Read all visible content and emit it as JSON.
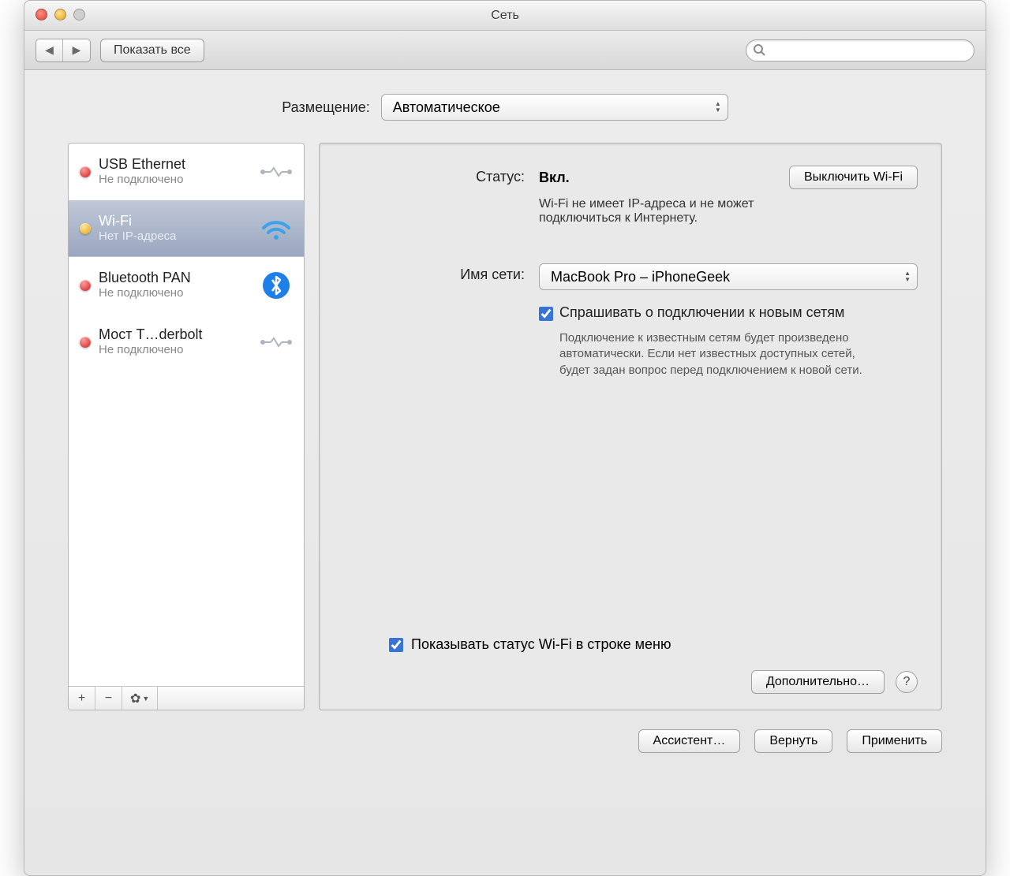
{
  "window": {
    "title": "Сеть"
  },
  "toolbar": {
    "show_all": "Показать все",
    "search_placeholder": ""
  },
  "location": {
    "label": "Размещение:",
    "value": "Автоматическое"
  },
  "sidebar": {
    "items": [
      {
        "name": "USB Ethernet",
        "status": "Не подключено",
        "dot": "red",
        "icon": "ethernet"
      },
      {
        "name": "Wi-Fi",
        "status": "Нет IP-адреса",
        "dot": "amber",
        "icon": "wifi"
      },
      {
        "name": "Bluetooth PAN",
        "status": "Не подключено",
        "dot": "red",
        "icon": "bluetooth"
      },
      {
        "name": "Мост T…derbolt",
        "status": "Не подключено",
        "dot": "red",
        "icon": "ethernet"
      }
    ],
    "selected_index": 1
  },
  "detail": {
    "status_label": "Статус:",
    "status_value": "Вкл.",
    "toggle_button": "Выключить Wi-Fi",
    "status_note": "Wi-Fi не имеет IP-адреса и не может подключиться к Интернету.",
    "network_label": "Имя сети:",
    "network_value": "MacBook Pro – iPhoneGeek",
    "ask_checkbox": "Спрашивать о подключении к новым сетям",
    "ask_help": "Подключение к известным сетям будет произведено автоматически. Если нет известных доступных сетей, будет задан вопрос перед подключением к новой сети.",
    "menubar_checkbox": "Показывать статус Wi-Fi в строке меню",
    "advanced_button": "Дополнительно…"
  },
  "footer": {
    "assistant": "Ассистент…",
    "revert": "Вернуть",
    "apply": "Применить"
  }
}
